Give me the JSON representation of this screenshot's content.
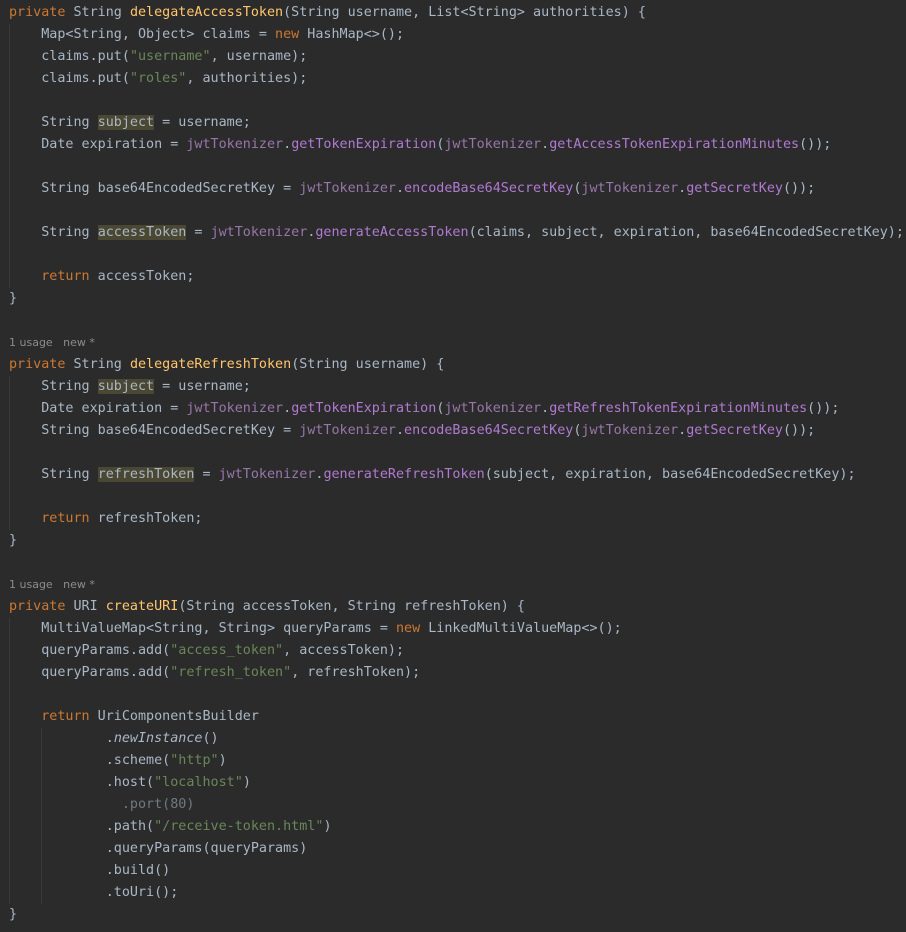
{
  "editor": {
    "lines": [
      [
        {
          "t": "private",
          "c": "kw"
        },
        {
          "t": " String "
        },
        {
          "t": "delegateAccessToken",
          "c": "fn"
        },
        {
          "t": "(String username, List<String> authorities) {"
        }
      ],
      [
        {
          "t": "    Map<String, Object> claims = "
        },
        {
          "t": "new",
          "c": "kw"
        },
        {
          "t": " HashMap<>();"
        }
      ],
      [
        {
          "t": "    claims.put("
        },
        {
          "t": "\"username\"",
          "c": "str"
        },
        {
          "t": ", username);"
        }
      ],
      [
        {
          "t": "    claims.put("
        },
        {
          "t": "\"roles\"",
          "c": "str"
        },
        {
          "t": ", authorities);"
        }
      ],
      [],
      [
        {
          "t": "    String "
        },
        {
          "t": "subject",
          "c": "hl"
        },
        {
          "t": " = username;"
        }
      ],
      [
        {
          "t": "    Date expiration = "
        },
        {
          "t": "jwtTokenizer",
          "c": "field"
        },
        {
          "t": "."
        },
        {
          "t": "getTokenExpiration",
          "c": "call"
        },
        {
          "t": "("
        },
        {
          "t": "jwtTokenizer",
          "c": "field"
        },
        {
          "t": "."
        },
        {
          "t": "getAccessTokenExpirationMinutes",
          "c": "call"
        },
        {
          "t": "());"
        }
      ],
      [],
      [
        {
          "t": "    String base64EncodedSecretKey = "
        },
        {
          "t": "jwtTokenizer",
          "c": "field"
        },
        {
          "t": "."
        },
        {
          "t": "encodeBase64SecretKey",
          "c": "call"
        },
        {
          "t": "("
        },
        {
          "t": "jwtTokenizer",
          "c": "field"
        },
        {
          "t": "."
        },
        {
          "t": "getSecretKey",
          "c": "call"
        },
        {
          "t": "());"
        }
      ],
      [],
      [
        {
          "t": "    String "
        },
        {
          "t": "accessToken",
          "c": "hl"
        },
        {
          "t": " = "
        },
        {
          "t": "jwtTokenizer",
          "c": "field"
        },
        {
          "t": "."
        },
        {
          "t": "generateAccessToken",
          "c": "call"
        },
        {
          "t": "(claims, subject, expiration, base64EncodedSecretKey);"
        }
      ],
      [],
      [
        {
          "t": "    "
        },
        {
          "t": "return",
          "c": "kw"
        },
        {
          "t": " accessToken;"
        }
      ],
      [
        {
          "t": "}"
        }
      ],
      [],
      [
        {
          "t": "1 usage   new *",
          "c": "hint"
        }
      ],
      [
        {
          "t": "private",
          "c": "kw"
        },
        {
          "t": " String "
        },
        {
          "t": "delegateRefreshToken",
          "c": "fn"
        },
        {
          "t": "(String username) {"
        }
      ],
      [
        {
          "t": "    String "
        },
        {
          "t": "subject",
          "c": "hl"
        },
        {
          "t": " = username;"
        }
      ],
      [
        {
          "t": "    Date expiration = "
        },
        {
          "t": "jwtTokenizer",
          "c": "field"
        },
        {
          "t": "."
        },
        {
          "t": "getTokenExpiration",
          "c": "call"
        },
        {
          "t": "("
        },
        {
          "t": "jwtTokenizer",
          "c": "field"
        },
        {
          "t": "."
        },
        {
          "t": "getRefreshTokenExpirationMinutes",
          "c": "call"
        },
        {
          "t": "());"
        }
      ],
      [
        {
          "t": "    String base64EncodedSecretKey = "
        },
        {
          "t": "jwtTokenizer",
          "c": "field"
        },
        {
          "t": "."
        },
        {
          "t": "encodeBase64SecretKey",
          "c": "call"
        },
        {
          "t": "("
        },
        {
          "t": "jwtTokenizer",
          "c": "field"
        },
        {
          "t": "."
        },
        {
          "t": "getSecretKey",
          "c": "call"
        },
        {
          "t": "());"
        }
      ],
      [],
      [
        {
          "t": "    String "
        },
        {
          "t": "refreshToken",
          "c": "hl"
        },
        {
          "t": " = "
        },
        {
          "t": "jwtTokenizer",
          "c": "field"
        },
        {
          "t": "."
        },
        {
          "t": "generateRefreshToken",
          "c": "call"
        },
        {
          "t": "(subject, expiration, base64EncodedSecretKey);"
        }
      ],
      [],
      [
        {
          "t": "    "
        },
        {
          "t": "return",
          "c": "kw"
        },
        {
          "t": " refreshToken;"
        }
      ],
      [
        {
          "t": "}"
        }
      ],
      [],
      [
        {
          "t": "1 usage   new *",
          "c": "hint"
        }
      ],
      [
        {
          "t": "private",
          "c": "kw"
        },
        {
          "t": " URI "
        },
        {
          "t": "createURI",
          "c": "fn"
        },
        {
          "t": "(String accessToken, String refreshToken) {"
        }
      ],
      [
        {
          "t": "    MultiValueMap<String, String> queryParams = "
        },
        {
          "t": "new",
          "c": "kw"
        },
        {
          "t": " LinkedMultiValueMap<>();"
        }
      ],
      [
        {
          "t": "    queryParams.add("
        },
        {
          "t": "\"access_token\"",
          "c": "str"
        },
        {
          "t": ", accessToken);"
        }
      ],
      [
        {
          "t": "    queryParams.add("
        },
        {
          "t": "\"refresh_token\"",
          "c": "str"
        },
        {
          "t": ", refreshToken);"
        }
      ],
      [],
      [
        {
          "t": "    "
        },
        {
          "t": "return",
          "c": "kw"
        },
        {
          "t": " UriComponentsBuilder"
        }
      ],
      [
        {
          "t": "            ."
        },
        {
          "t": "newInstance",
          "c": "it"
        },
        {
          "t": "()"
        }
      ],
      [
        {
          "t": "            .scheme("
        },
        {
          "t": "\"http\"",
          "c": "str"
        },
        {
          "t": ")"
        }
      ],
      [
        {
          "t": "            .host("
        },
        {
          "t": "\"localhost\"",
          "c": "str"
        },
        {
          "t": ")"
        }
      ],
      [
        {
          "t": "              .port(80)",
          "c": "dim"
        }
      ],
      [
        {
          "t": "            .path("
        },
        {
          "t": "\"/receive-token.html\"",
          "c": "str"
        },
        {
          "t": ")"
        }
      ],
      [
        {
          "t": "            .queryParams(queryParams)"
        }
      ],
      [
        {
          "t": "            .build()"
        }
      ],
      [
        {
          "t": "            .toUri();"
        }
      ],
      [
        {
          "t": "}"
        }
      ]
    ]
  }
}
